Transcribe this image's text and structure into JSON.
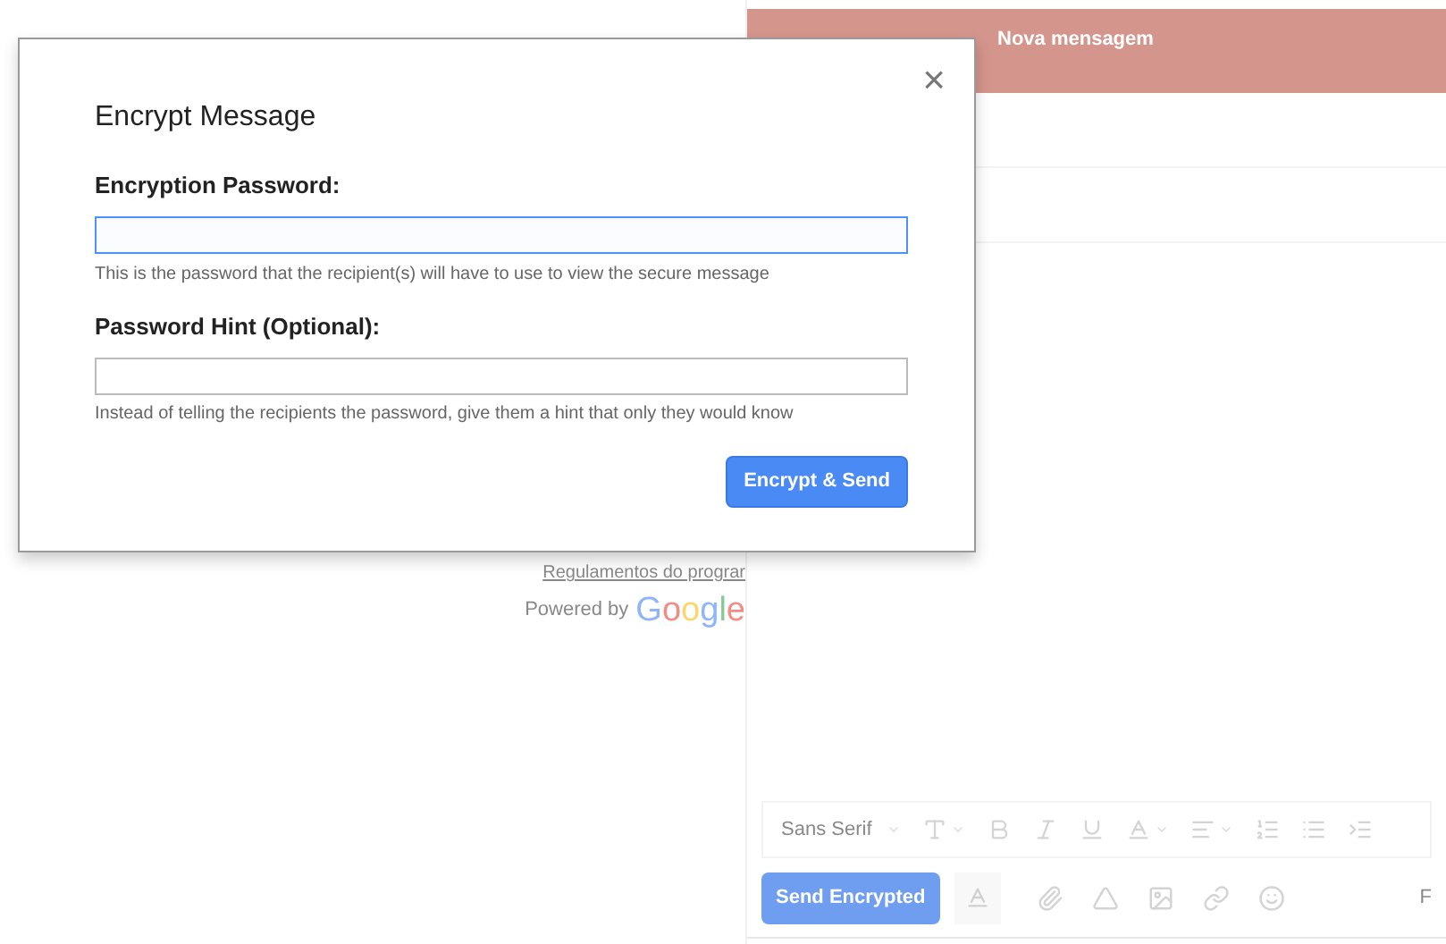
{
  "compose": {
    "title": "Nova mensagem",
    "font_menu": "Sans Serif",
    "send_button": "Send Encrypted",
    "trailing_text": "F"
  },
  "background": {
    "link": "Regulamentos do prograr",
    "powered_by": "Powered by",
    "logo": "Google"
  },
  "dialog": {
    "title": "Encrypt Message",
    "close": "×",
    "fields": [
      {
        "label": "Encryption Password:",
        "help": "This is the password that the recipient(s) will have to use to view the secure message",
        "focused": true
      },
      {
        "label": "Password Hint (Optional):",
        "help": "Instead of telling the recipients the password, give them a hint that only they would know",
        "focused": false
      }
    ],
    "submit": "Encrypt & Send"
  }
}
